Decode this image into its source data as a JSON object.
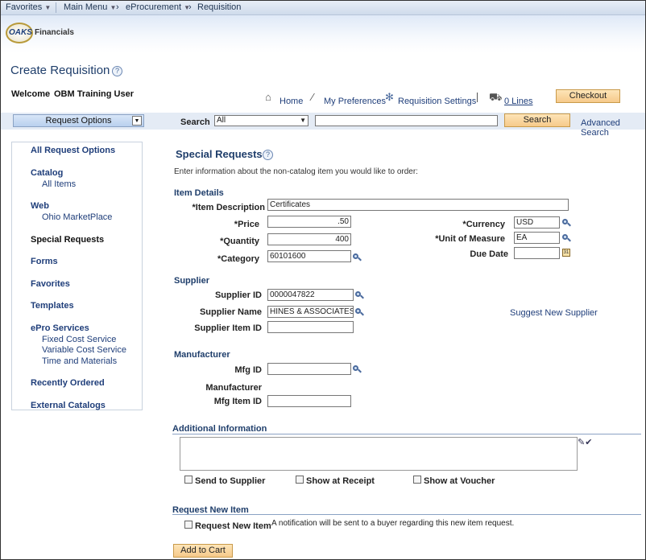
{
  "topnav": {
    "favorites": "Favorites",
    "main_menu": "Main Menu",
    "eprocurement": "eProcurement",
    "requisition": "Requisition"
  },
  "logo": {
    "mark": "OAKS",
    "text": "Financials"
  },
  "page": {
    "title": "Create Requisition"
  },
  "welcome": {
    "label": "Welcome",
    "user": "OBM Training User"
  },
  "toplinks": {
    "home": "Home",
    "my_preferences": "My Preferences",
    "requisition_settings": "Requisition Settings",
    "lines": "0 Lines",
    "checkout": "Checkout"
  },
  "searchbar": {
    "request_options": "Request Options",
    "search_label": "Search",
    "search_scope": "All",
    "search_query": "",
    "search_button": "Search",
    "advanced_search": "Advanced Search"
  },
  "sidebar": {
    "all_request_options": "All Request Options",
    "catalog": "Catalog",
    "all_items": "All Items",
    "web": "Web",
    "ohio_marketplace": "Ohio MarketPlace",
    "special_requests": "Special Requests",
    "forms": "Forms",
    "favorites": "Favorites",
    "templates": "Templates",
    "epro_services": "ePro Services",
    "fixed_cost_service": "Fixed Cost Service",
    "variable_cost_service": "Variable Cost Service",
    "time_and_materials": "Time and Materials",
    "recently_ordered": "Recently Ordered",
    "external_catalogs": "External Catalogs"
  },
  "main": {
    "section_title": "Special Requests",
    "intro": "Enter information about the non-catalog item you would like to order:",
    "item_details": {
      "heading": "Item Details",
      "item_description_label": "*Item Description",
      "item_description": "Certificates",
      "price_label": "*Price",
      "price": ".50",
      "quantity_label": "*Quantity",
      "quantity": "400",
      "category_label": "*Category",
      "category": "60101600",
      "currency_label": "*Currency",
      "currency": "USD",
      "uom_label": "*Unit of Measure",
      "uom": "EA",
      "due_date_label": "Due Date",
      "due_date": ""
    },
    "supplier": {
      "heading": "Supplier",
      "supplier_id_label": "Supplier ID",
      "supplier_id": "0000047822",
      "supplier_name_label": "Supplier Name",
      "supplier_name": "HINES & ASSOCIATES",
      "supplier_item_id_label": "Supplier Item ID",
      "supplier_item_id": "",
      "suggest_new_supplier": "Suggest New Supplier"
    },
    "manufacturer": {
      "heading": "Manufacturer",
      "mfg_id_label": "Mfg ID",
      "mfg_id": "",
      "manufacturer_label": "Manufacturer",
      "mfg_item_id_label": "Mfg Item ID",
      "mfg_item_id": ""
    },
    "additional_information": {
      "heading": "Additional Information",
      "send_to_supplier": "Send to Supplier",
      "show_at_receipt": "Show at Receipt",
      "show_at_voucher": "Show at Voucher"
    },
    "request_new_item": {
      "heading": "Request New Item",
      "checkbox_label": "Request New Item",
      "note": "A notification will be sent to a buyer regarding this new item request."
    },
    "add_to_cart": "Add to Cart"
  },
  "icons": {
    "search": "magnifier-icon",
    "calendar": "calendar-icon",
    "help": "help-icon",
    "home": "home-icon",
    "preferences": "wand-icon",
    "settings": "gear-icon",
    "cart": "cart-icon",
    "spellcheck": "spellcheck-icon"
  },
  "colors": {
    "accent_blue": "#1f3e7a",
    "button_orange": "#f6c98a",
    "nav_bg": "#cfdbeb"
  }
}
